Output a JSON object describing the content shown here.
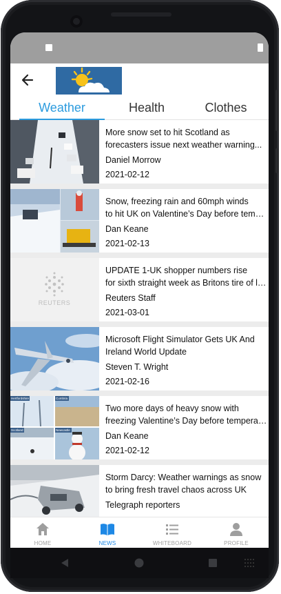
{
  "colors": {
    "accent": "#2b9bde",
    "nav_active": "#1e88e5",
    "nav_inactive": "#a0a0a0",
    "status_bar": "#9e9e9e"
  },
  "appbar": {
    "back_icon": "arrow-left-icon",
    "logo": "weather-sun-cloud-logo"
  },
  "tabs": [
    {
      "label": "Weather",
      "active": true
    },
    {
      "label": "Health",
      "active": false
    },
    {
      "label": "Clothes",
      "active": false
    }
  ],
  "articles": [
    {
      "title_line1": "More snow set to hit Scotland as",
      "title_line2": "forecasters issue next weather warning...",
      "author": "Daniel Morrow",
      "date": "2021-02-12",
      "thumb": "snowy-street-photo"
    },
    {
      "title_line1": "Snow, freezing rain and 60mph winds",
      "title_line2": "to hit UK on Valentine’s Day before temperatures...",
      "author": "Dan Keane",
      "date": "2021-02-13",
      "thumb": "snow-collage-photo"
    },
    {
      "title_line1": "UPDATE 1-UK shopper numbers rise",
      "title_line2": "for sixth straight week as Britons tire of lockdown",
      "author": "Reuters Staff",
      "date": "2021-03-01",
      "thumb": "reuters-logo",
      "thumb_text": "REUTERS"
    },
    {
      "title_line1": "Microsoft Flight Simulator Gets UK And",
      "title_line2": "Ireland World Update",
      "author": "Steven T. Wright",
      "date": "2021-02-16",
      "thumb": "airplane-photo"
    },
    {
      "title_line1": "Two more days of heavy snow with",
      "title_line2": "freezing Valentine’s Day before temperatures...",
      "author": "Dan Keane",
      "date": "2021-02-12",
      "thumb": "snow-grid-photo",
      "thumb_tags": [
        "Hertfordshire",
        "Cumbria",
        "Scotland",
        "Newcastle"
      ]
    },
    {
      "title_line1": "Storm Darcy: Weather warnings as snow",
      "title_line2": "to bring fresh travel chaos across UK",
      "author": "Telegraph reporters",
      "date": "",
      "thumb": "crashed-car-snow-photo"
    }
  ],
  "bottom_nav": [
    {
      "label": "HOME",
      "icon": "home-icon",
      "active": false
    },
    {
      "label": "NEWS",
      "icon": "book-icon",
      "active": true
    },
    {
      "label": "WHITEBOARD",
      "icon": "list-icon",
      "active": false
    },
    {
      "label": "PROFILE",
      "icon": "person-icon",
      "active": false
    }
  ],
  "system_nav": {
    "back": "back-triangle-icon",
    "home": "home-circle-icon",
    "recents": "recents-square-icon"
  }
}
